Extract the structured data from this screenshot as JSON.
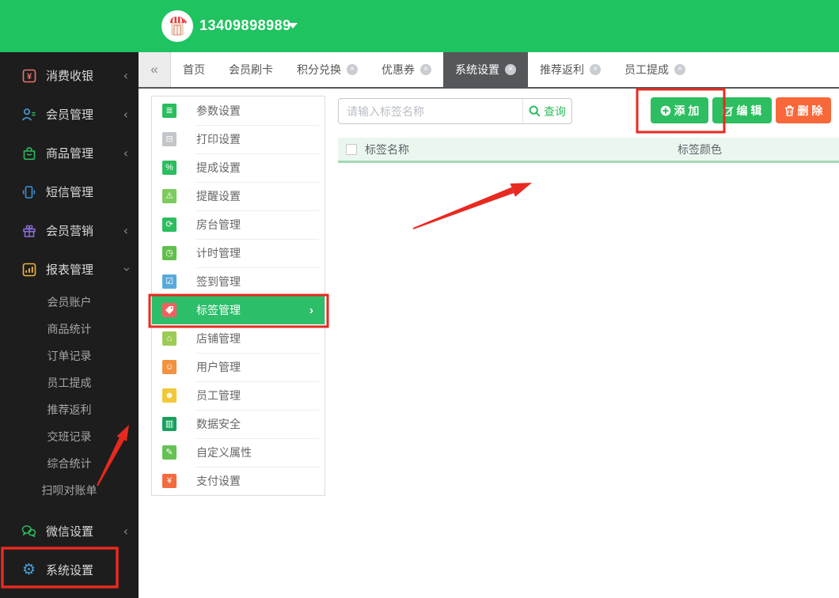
{
  "topbar": {
    "phone": "13409898989"
  },
  "tab_bar": {
    "collapse": "«",
    "tabs": [
      {
        "label": "首页",
        "closable": false,
        "active": false
      },
      {
        "label": "会员刷卡",
        "closable": false,
        "active": false
      },
      {
        "label": "积分兑换",
        "closable": true,
        "active": false
      },
      {
        "label": "优惠券",
        "closable": true,
        "active": false
      },
      {
        "label": "系统设置",
        "closable": true,
        "active": true
      },
      {
        "label": "推荐返利",
        "closable": true,
        "active": false
      },
      {
        "label": "员工提成",
        "closable": true,
        "active": false
      }
    ],
    "close_glyph": "×"
  },
  "sidebar": {
    "main_items": [
      {
        "label": "消费收银",
        "icon": "cashier-icon",
        "chevron": "‹"
      },
      {
        "label": "会员管理",
        "icon": "member-icon",
        "chevron": "‹"
      },
      {
        "label": "商品管理",
        "icon": "goods-icon",
        "chevron": "‹"
      },
      {
        "label": "短信管理",
        "icon": "sms-icon",
        "chevron": ""
      },
      {
        "label": "会员营销",
        "icon": "marketing-icon",
        "chevron": "‹"
      },
      {
        "label": "报表管理",
        "icon": "report-icon",
        "chevron": "‹",
        "expanded": true
      }
    ],
    "report_subitems": [
      "会员账户",
      "商品统计",
      "订单记录",
      "员工提成",
      "推荐返利",
      "交班记录",
      "综合统计",
      "扫呗对账单"
    ],
    "bottom_items": [
      {
        "label": "微信设置",
        "icon": "wechat-icon",
        "chevron": "‹"
      },
      {
        "label": "系统设置",
        "icon": "gear-icon",
        "chevron": ""
      }
    ]
  },
  "settings_menu": {
    "items": [
      {
        "label": "参数设置",
        "icon": "sliders-icon",
        "bg": "#2cbd5f",
        "glyph": "≣"
      },
      {
        "label": "打印设置",
        "icon": "printer-icon",
        "bg": "#c3c6c9",
        "glyph": "⊟"
      },
      {
        "label": "提成设置",
        "icon": "commission-icon",
        "bg": "#2cbd5f",
        "glyph": "%"
      },
      {
        "label": "提醒设置",
        "icon": "bell-icon",
        "bg": "#7ccb5e",
        "glyph": "⚠"
      },
      {
        "label": "房台管理",
        "icon": "room-table-icon",
        "bg": "#2cbd5f",
        "glyph": "⟳"
      },
      {
        "label": "计时管理",
        "icon": "timer-icon",
        "bg": "#5fc04a",
        "glyph": "◷"
      },
      {
        "label": "签到管理",
        "icon": "checkin-icon",
        "bg": "#57aadb",
        "glyph": "☑"
      },
      {
        "label": "标签管理",
        "icon": "tag-icon",
        "bg": "#f45f5f",
        "glyph": "",
        "selected": true,
        "chevron": "›"
      },
      {
        "label": "店铺管理",
        "icon": "shop-icon",
        "bg": "#9ccb56",
        "glyph": "⌂"
      },
      {
        "label": "用户管理",
        "icon": "user-icon",
        "bg": "#f2913f",
        "glyph": "☺"
      },
      {
        "label": "员工管理",
        "icon": "staff-icon",
        "bg": "#f3c73a",
        "glyph": "☻"
      },
      {
        "label": "数据安全",
        "icon": "data-security-icon",
        "bg": "#18a05c",
        "glyph": "▥"
      },
      {
        "label": "自定义属性",
        "icon": "custom-attr-icon",
        "bg": "#64c254",
        "glyph": "✎"
      },
      {
        "label": "支付设置",
        "icon": "payment-icon",
        "bg": "#f26b3f",
        "glyph": "¥"
      }
    ]
  },
  "toolbar": {
    "search_placeholder": "请输入标签名称",
    "search_value": "",
    "query": "查询",
    "add": "添 加",
    "edit": "编 辑",
    "delete": "删 除"
  },
  "table": {
    "columns": [
      "标签名称",
      "标签颜色"
    ],
    "rows": []
  },
  "colors": {
    "topbar_green": "#1fc35f",
    "brand_green": "#2cbe60",
    "danger_orange": "#f8683a",
    "active_tab_gray": "#54585b",
    "table_header_bg": "#eaf7ef",
    "annotation_red": "#e8291f"
  }
}
